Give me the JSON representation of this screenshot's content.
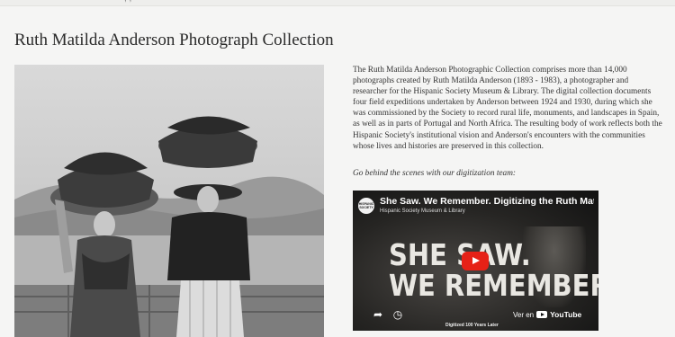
{
  "page": {
    "title": "Ruth Matilda Anderson Photograph Collection",
    "top_nav_fragment": ", ,"
  },
  "photo": {
    "description": "Black and white photograph of two women carrying large baskets of greens on their heads"
  },
  "description": {
    "body": "The Ruth Matilda Anderson Photographic Collection comprises more than 14,000 photographs created by Ruth Matilda Anderson (1893 - 1983), a photographer and researcher for the Hispanic Society Museum & Library. The digital collection documents four field expeditions undertaken by Anderson between 1924 and 1930, during which she was commissioned by the Society to record rural life, monuments, and landscapes in Spain, as well as in parts of Portugal and North Africa. The resulting body of work reflects both the Hispanic Society's institutional vision and Anderson's encounters with the communities whose lives and histories are preserved in this collection.",
    "lead_in": "Go behind the scenes with our digitization team:"
  },
  "video": {
    "title": "She Saw. We Remember. Digitizing the Ruth Matilda Anderson Collection",
    "channel": "Hispanic Society Museum & Library",
    "channel_avatar_text": "HISPANIC SOCIETY",
    "overlay_line1": "SHE SAW.",
    "overlay_line2": "WE REMEMBER.",
    "watch_on_label": "Ver en",
    "platform_label": "YouTube",
    "bottom_caption": "Digitized 100 Years Later",
    "icons": {
      "share": "share-icon",
      "watch_later": "clock-icon",
      "play": "play-icon"
    },
    "accent_color": "#e62117"
  }
}
